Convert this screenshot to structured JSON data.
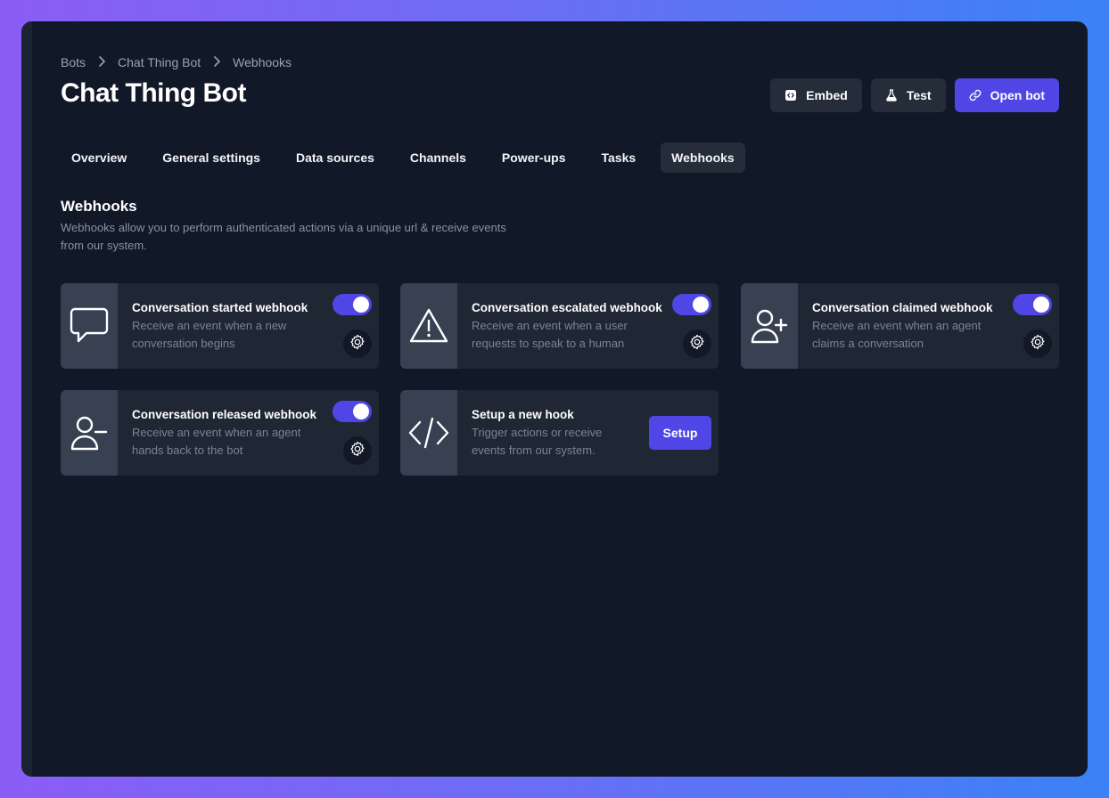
{
  "breadcrumb": [
    "Bots",
    "Chat Thing Bot",
    "Webhooks"
  ],
  "page_title": "Chat Thing Bot",
  "actions": {
    "embed": {
      "label": "Embed",
      "icon": "code-square-icon"
    },
    "test": {
      "label": "Test",
      "icon": "flask-icon"
    },
    "open_bot": {
      "label": "Open bot",
      "icon": "link-icon"
    }
  },
  "tabs": [
    {
      "label": "Overview",
      "active": false
    },
    {
      "label": "General settings",
      "active": false
    },
    {
      "label": "Data sources",
      "active": false
    },
    {
      "label": "Channels",
      "active": false
    },
    {
      "label": "Power-ups",
      "active": false
    },
    {
      "label": "Tasks",
      "active": false
    },
    {
      "label": "Webhooks",
      "active": true
    }
  ],
  "section": {
    "title": "Webhooks",
    "description": "Webhooks allow you to perform authenticated actions via a unique url & receive events from our system."
  },
  "webhooks": [
    {
      "title": "Conversation started webhook",
      "description": "Receive an event when a new conversation begins",
      "icon": "chat-bubble-icon",
      "enabled": true
    },
    {
      "title": "Conversation escalated webhook",
      "description": "Receive an event when a user requests to speak to a human",
      "icon": "warning-triangle-icon",
      "enabled": true
    },
    {
      "title": "Conversation claimed webhook",
      "description": "Receive an event when an agent claims a conversation",
      "icon": "user-plus-icon",
      "enabled": true
    },
    {
      "title": "Conversation released webhook",
      "description": "Receive an event when an agent hands back to the bot",
      "icon": "user-minus-icon",
      "enabled": true
    }
  ],
  "new_hook": {
    "title": "Setup a new hook",
    "description": "Trigger actions or receive events from our system.",
    "button": "Setup",
    "icon": "code-icon"
  },
  "colors": {
    "accent": "#4f46e5",
    "background": "#111827",
    "card": "#1f2734",
    "icon_box": "#374151"
  }
}
